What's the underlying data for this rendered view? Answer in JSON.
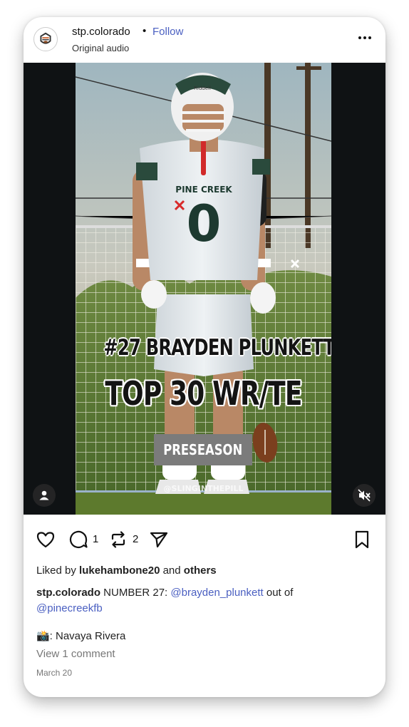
{
  "post": {
    "username": "stp.colorado",
    "separator": "•",
    "follow_label": "Follow",
    "audio_label": "Original audio",
    "media": {
      "player_name": "#27 BRAYDEN PLUNKETT",
      "ranking": "TOP 30 WR/TE",
      "badge": "PRESEASON",
      "watermark": "@SLINGINTHEPILL",
      "jersey_team": "PINE CREEK",
      "jersey_number": "0",
      "helmet_brand": "Riddell"
    },
    "actions": {
      "comment_count": "1",
      "repost_count": "2"
    },
    "likes": {
      "prefix": "Liked by ",
      "user": "lukehambone20",
      "middle": " and ",
      "others": "others"
    },
    "caption": {
      "user": "stp.colorado",
      "text_1": " NUMBER 27: ",
      "mention_1": "@brayden_plunkett",
      "text_2": " out of ",
      "mention_2": "@pinecreekfb"
    },
    "credit": "📸: Navaya Rivera",
    "view_comments": "View 1 comment",
    "date": "March 20"
  },
  "colors": {
    "link": "#4a5fc1",
    "media_bg": "#0f1214",
    "badge_bg": "#7b7b7b"
  }
}
